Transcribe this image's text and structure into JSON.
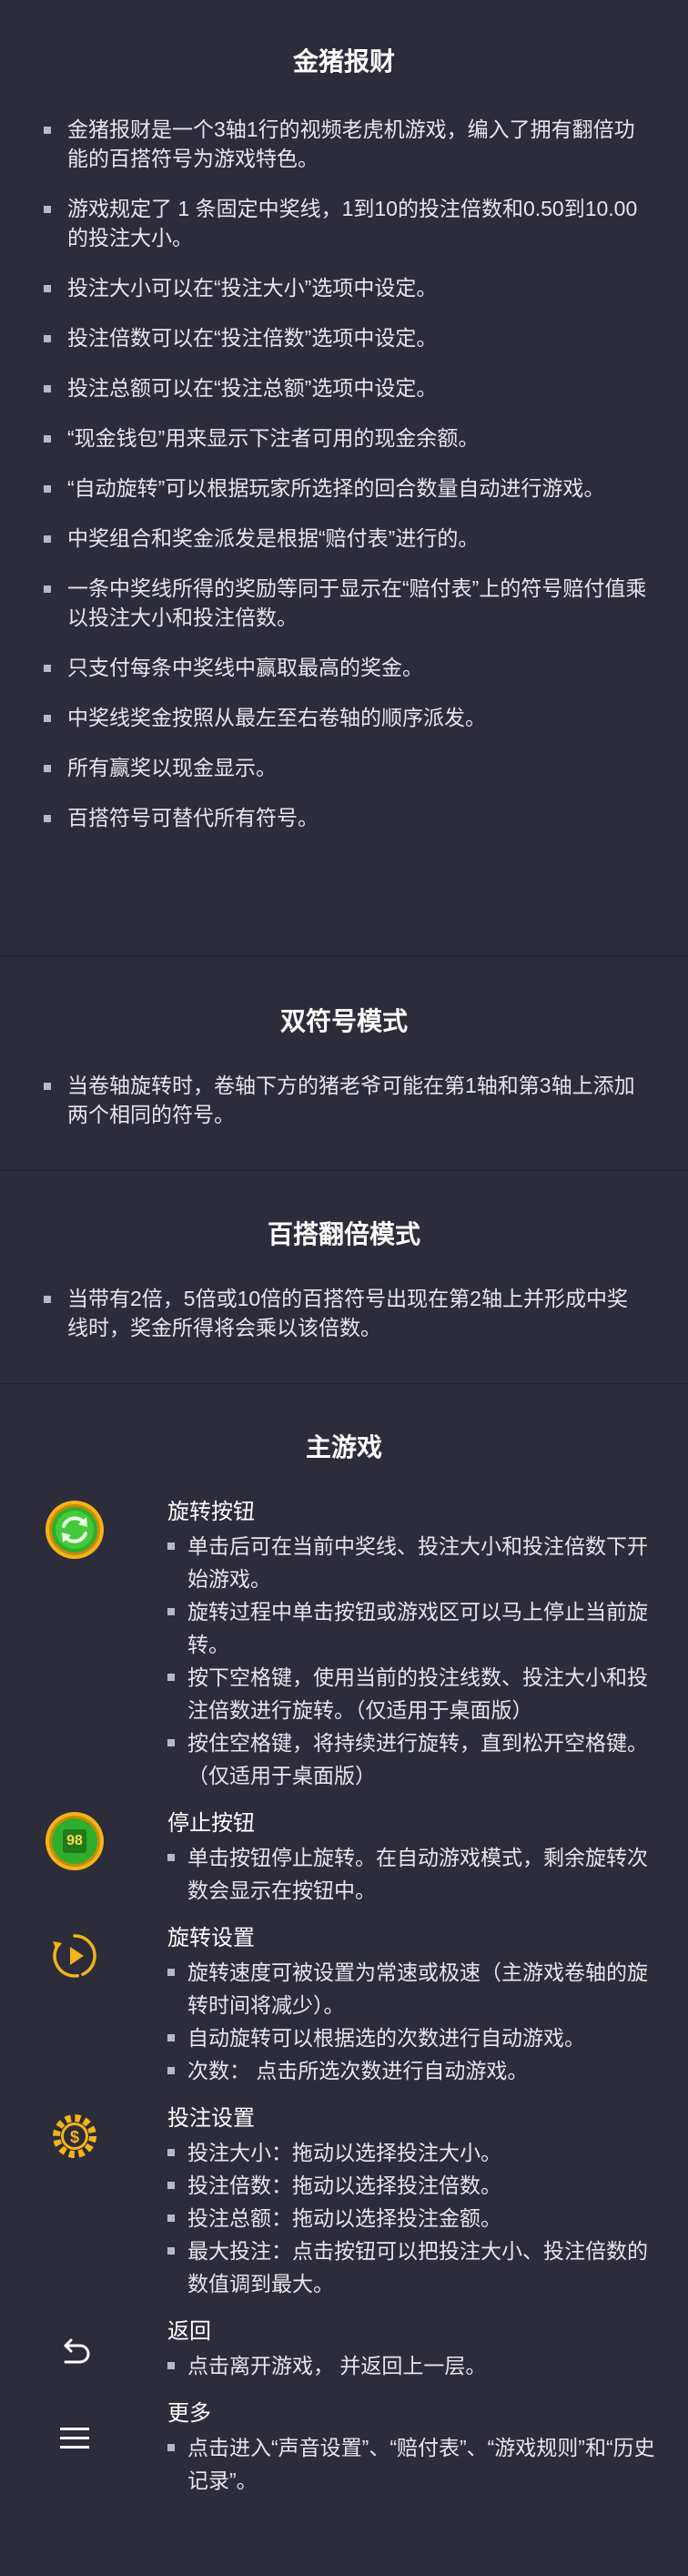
{
  "section1": {
    "title": "金猪报财",
    "items": [
      "金猪报财是一个3轴1行的视频老虎机游戏，编入了拥有翻倍功能的百搭符号为游戏特色。",
      "游戏规定了 1 条固定中奖线，1到10的投注倍数和0.50到10.00 的投注大小。",
      "投注大小可以在“投注大小”选项中设定。",
      "投注倍数可以在“投注倍数”选项中设定。",
      "投注总额可以在“投注总额”选项中设定。",
      "“现金钱包”用来显示下注者可用的现金余额。",
      "“自动旋转”可以根据玩家所选择的回合数量自动进行游戏。",
      "中奖组合和奖金派发是根据“赔付表”进行的。",
      "一条中奖线所得的奖励等同于显示在“赔付表”上的符号赔付值乘以投注大小和投注倍数。",
      "只支付每条中奖线中赢取最高的奖金。",
      "中奖线奖金按照从最左至右卷轴的顺序派发。",
      "所有赢奖以现金显示。",
      "百搭符号可替代所有符号。"
    ]
  },
  "section2": {
    "title": "双符号模式",
    "items": [
      "当卷轴旋转时，卷轴下方的猪老爷可能在第1轴和第3轴上添加两个相同的符号。"
    ]
  },
  "section3": {
    "title": "百搭翻倍模式",
    "items": [
      "当带有2倍，5倍或10倍的百搭符号出现在第2轴上并形成中奖线时，奖金所得将会乘以该倍数。"
    ]
  },
  "main_game": {
    "title": "主游戏",
    "features": [
      {
        "icon": "spin-button-icon",
        "name": "旋转按钮",
        "items": [
          "单击后可在当前中奖线、投注大小和投注倍数下开始游戏。",
          "旋转过程中单击按钮或游戏区可以马上停止当前旋转。",
          "按下空格键，使用当前的投注线数、投注大小和投注倍数进行旋转。（仅适用于桌面版）",
          "按住空格键，将持续进行旋转，直到松开空格键。（仅适用于桌面版）"
        ]
      },
      {
        "icon": "stop-button-icon",
        "name": "停止按钮",
        "icon_text": "98",
        "items": [
          "单击按钮停止旋转。在自动游戏模式，剩余旋转次数会显示在按钮中。"
        ]
      },
      {
        "icon": "autoplay-icon",
        "name": "旋转设置",
        "items": [
          "旋转速度可被设置为常速或极速（主游戏卷轴的旋转时间将减少）。",
          "自动旋转可以根据选的次数进行自动游戏。",
          "次数： 点击所选次数进行自动游戏。"
        ]
      },
      {
        "icon": "bet-settings-icon",
        "name": "投注设置",
        "items": [
          "投注大小：拖动以选择投注大小。",
          "投注倍数：拖动以选择投注倍数。",
          "投注总额：拖动以选择投注金额。",
          "最大投注：点击按钮可以把投注大小、投注倍数的数值调到最大。"
        ]
      },
      {
        "icon": "return-arrow-icon",
        "name": "返回",
        "items": [
          "点击离开游戏， 并返回上一层。"
        ]
      },
      {
        "icon": "menu-icon",
        "name": "更多",
        "items": [
          "点击进入“声音设置”、“赔付表”、“游戏规则”和“历史记录”。"
        ]
      }
    ]
  },
  "colors": {
    "background": "#2d2c3a",
    "divider": "#24232f",
    "gold": "#f2b418",
    "green": "#2fae2c"
  }
}
